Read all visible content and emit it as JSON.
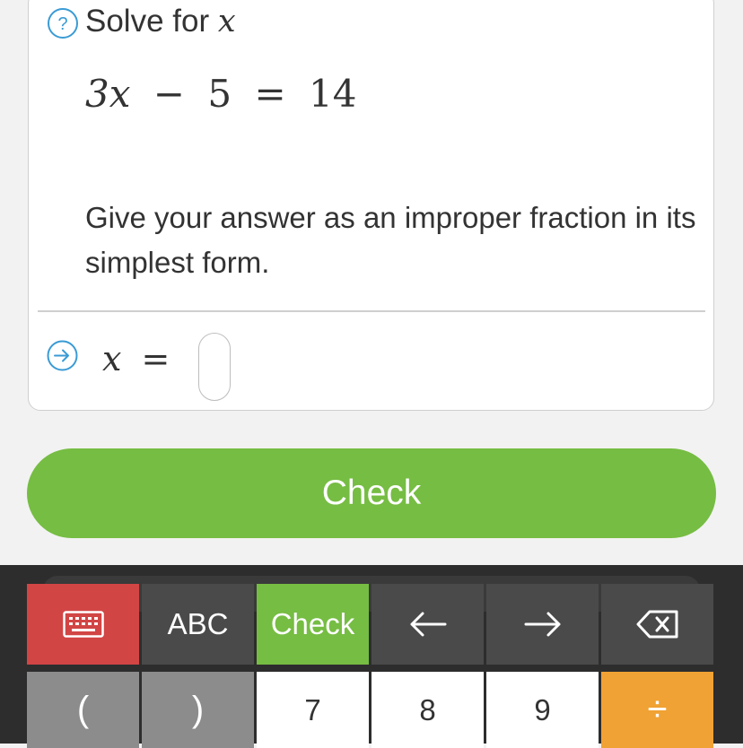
{
  "question": {
    "title": "Solve for",
    "title_var": "x",
    "equation": {
      "coef_var": "3x",
      "minus": "−",
      "constant": "5",
      "equals": "=",
      "rhs": "14"
    },
    "instruction": "Give your answer as an improper fraction in its simplest form."
  },
  "answer": {
    "lhs_var": "x",
    "equals": "=",
    "value": ""
  },
  "check_button_label": "Check",
  "keyboard": {
    "row1": {
      "keyboard_toggle_icon": "keyboard-icon",
      "abc_label": "ABC",
      "check_label": "Check",
      "left_arrow": "←",
      "right_arrow": "→",
      "backspace_icon": "backspace-icon"
    },
    "row2": {
      "open_paren": "(",
      "close_paren": ")",
      "seven": "7",
      "eight": "8",
      "nine": "9",
      "divide": "÷"
    }
  },
  "colors": {
    "accent_green": "#76bd43",
    "key_red": "#d24545",
    "key_orange": "#f0a234",
    "icon_blue": "#3a9bd5"
  }
}
